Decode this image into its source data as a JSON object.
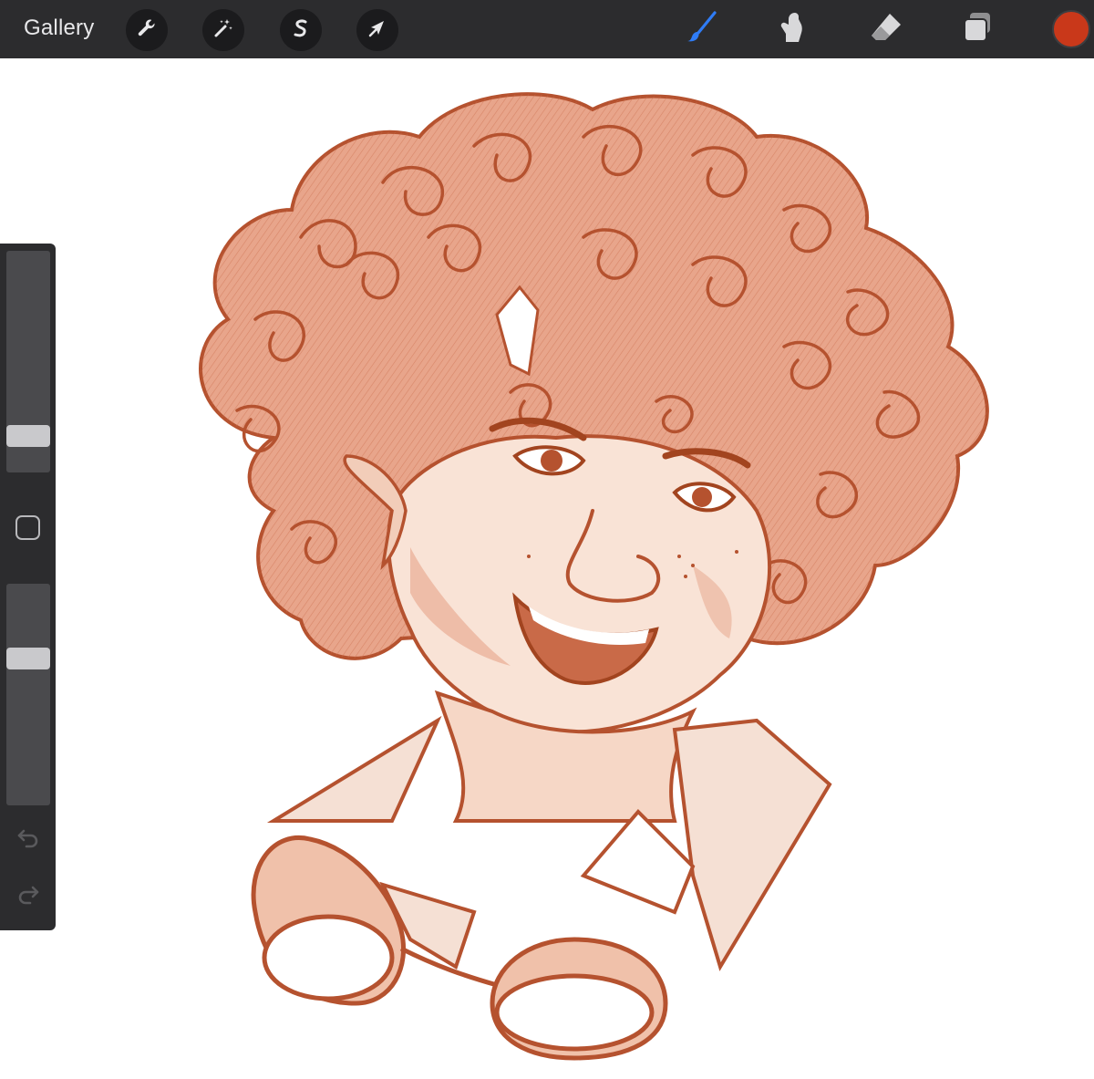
{
  "toolbar": {
    "gallery_label": "Gallery",
    "actions_icon": "wrench-icon",
    "adjustments_icon": "magic-wand-icon",
    "selection_icon": "selection-s-icon",
    "transform_icon": "arrow-cursor-icon",
    "brush_icon": "brush-icon",
    "smudge_icon": "smudge-finger-icon",
    "eraser_icon": "eraser-icon",
    "layers_icon": "layers-icon",
    "active_tool": "brush",
    "active_color": "#c9381a",
    "accent": "#2f7cf6"
  },
  "sidebar": {
    "brush_size_level": 0.13,
    "opacity_level": 0.68,
    "modify_icon": "square-modify-icon",
    "undo_icon": "undo-arrow-icon",
    "redo_icon": "redo-arrow-icon"
  },
  "canvas": {
    "ink_color": "#b5522f",
    "fill_color": "#e7a489",
    "shade_color": "#d98262"
  }
}
